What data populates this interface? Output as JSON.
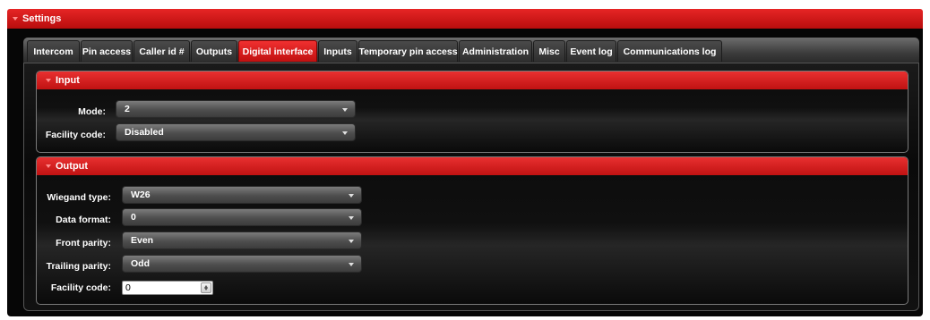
{
  "panel": {
    "title": "Settings"
  },
  "tabs": [
    {
      "label": "Intercom"
    },
    {
      "label": "Pin access"
    },
    {
      "label": "Caller id #"
    },
    {
      "label": "Outputs"
    },
    {
      "label": "Digital interface",
      "active": true
    },
    {
      "label": "Inputs"
    },
    {
      "label": "Temporary pin access"
    },
    {
      "label": "Administration"
    },
    {
      "label": "Misc"
    },
    {
      "label": "Event log"
    },
    {
      "label": "Communications log"
    }
  ],
  "input_section": {
    "title": "Input",
    "mode": {
      "label": "Mode:",
      "value": "2"
    },
    "facility_code": {
      "label": "Facility code:",
      "value": "Disabled"
    }
  },
  "output_section": {
    "title": "Output",
    "wiegand_type": {
      "label": "Wiegand type:",
      "value": "W26"
    },
    "data_format": {
      "label": "Data format:",
      "value": "0"
    },
    "front_parity": {
      "label": "Front parity:",
      "value": "Even"
    },
    "trailing_parity": {
      "label": "Trailing parity:",
      "value": "Odd"
    },
    "facility_code": {
      "label": "Facility code:",
      "value": "0"
    }
  },
  "colors": {
    "accent": "#d41a1a",
    "background": "#060606"
  }
}
